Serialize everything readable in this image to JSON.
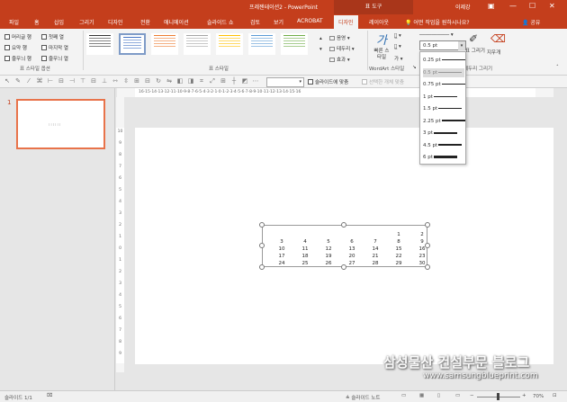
{
  "window": {
    "title": "프레젠테이션2 - PowerPoint",
    "context_header": "표 도구",
    "user": "이제강",
    "controls": [
      "restore-icon",
      "minimize-icon",
      "maximize-icon",
      "close-icon"
    ]
  },
  "tabs": [
    "파일",
    "홈",
    "삽입",
    "그리기",
    "디자인",
    "전환",
    "애니메이션",
    "슬라이드 쇼",
    "검토",
    "보기",
    "ACROBAT",
    "디자인",
    "레이아웃"
  ],
  "tell_me": "어떤 작업을 원하시나요?",
  "share": "공유",
  "style_options": {
    "items": [
      "머리글 행",
      "요약 행",
      "줄무늬 행",
      "첫째 열",
      "마지막 열",
      "줄무늬 열"
    ],
    "group_label": "표 스타일 옵션"
  },
  "table_styles": {
    "group_label": "표 스타일",
    "swatches": [
      "#333333",
      "#4472c4",
      "#ed7d31",
      "#a5a5a5",
      "#ffc000",
      "#5b9bd5",
      "#70ad47"
    ]
  },
  "shading": {
    "fill": "음영",
    "border": "테두리",
    "effect": "효과"
  },
  "wordart": {
    "quick_styles": "빠른 스타일",
    "group_label": "WordArt 스타일"
  },
  "draw_borders": {
    "pen_weight": "0.5 pt",
    "draw_table": "표 그리기",
    "eraser": "지우개",
    "group_label": "테두리 그리기"
  },
  "pen_weight_menu": [
    "0.25 pt",
    "0.5 pt",
    "0.75 pt",
    "1 pt",
    "1.5 pt",
    "2.25 pt",
    "3 pt",
    "4.5 pt",
    "6 pt"
  ],
  "toolbar2": {
    "snap_to_slide": "슬라이드에 맞춤",
    "snap_to_selected": "선택한 개체 맞춤"
  },
  "ruler": {
    "horizontal": "16·15·14·13·12·11·10·9·8·7·6·5·4·3·2·1·0·1·2·3·4·5·6·7·8·9·10·11·12·13·14·15·16",
    "vertical": [
      "10",
      "9",
      "8",
      "7",
      "6",
      "5",
      "4",
      "3",
      "2",
      "1",
      "0",
      "1",
      "2",
      "3",
      "4",
      "5",
      "6",
      "7",
      "8",
      "9"
    ]
  },
  "slides": {
    "number": "1",
    "thumb_marks": "ıııııı"
  },
  "calendar": {
    "rows": [
      [
        "",
        "",
        "",
        "",
        "",
        "1",
        "2"
      ],
      [
        "3",
        "4",
        "5",
        "6",
        "7",
        "8",
        "9"
      ],
      [
        "10",
        "11",
        "12",
        "13",
        "14",
        "15",
        "16"
      ],
      [
        "17",
        "18",
        "19",
        "20",
        "21",
        "22",
        "23"
      ],
      [
        "24",
        "25",
        "26",
        "27",
        "28",
        "29",
        "30"
      ]
    ]
  },
  "status": {
    "slide_info": "슬라이드 1/1",
    "notes": "슬라이드 노트",
    "zoom": "70%"
  },
  "watermark": {
    "name": "삼성물산 건설부문 블로그",
    "url": "www.samsungblueprint.com"
  },
  "colors": {
    "accent": "#c43e1c",
    "selection": "#e8734a"
  }
}
